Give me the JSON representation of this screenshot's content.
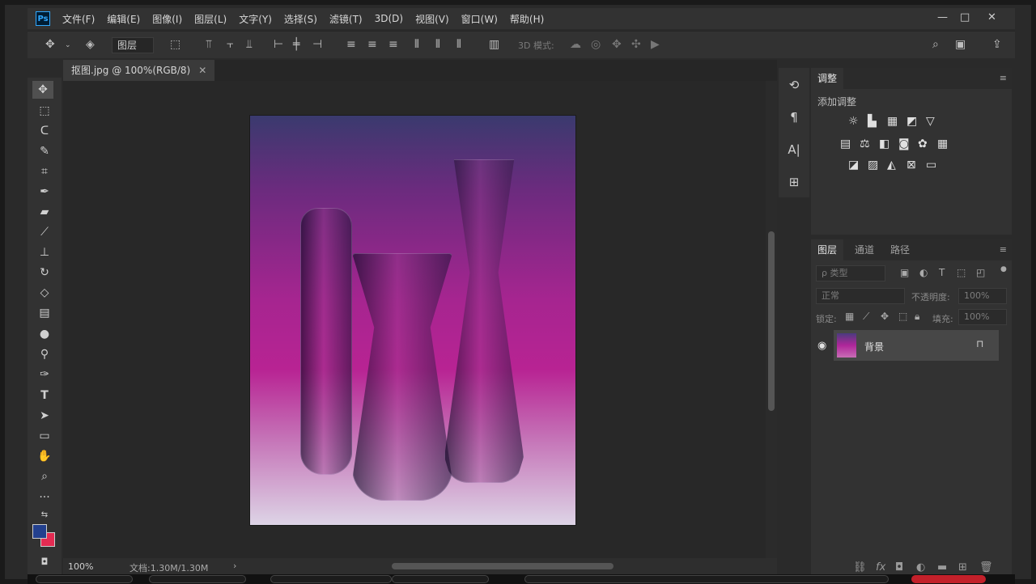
{
  "app": {
    "logo": "Ps"
  },
  "menu": [
    "文件(F)",
    "编辑(E)",
    "图像(I)",
    "图层(L)",
    "文字(Y)",
    "选择(S)",
    "滤镜(T)",
    "3D(D)",
    "视图(V)",
    "窗口(W)",
    "帮助(H)"
  ],
  "window_controls": {
    "minimize": "—",
    "restore": "□",
    "close": "✕"
  },
  "options": {
    "layer_select": "图层",
    "mode_label": "3D 模式:"
  },
  "document": {
    "tab_title": "抠图.jpg @ 100%(RGB/8)",
    "close": "✕"
  },
  "status": {
    "zoom": "100%",
    "doc_info": "文档:1.30M/1.30M",
    "arrow": "›"
  },
  "tools": [
    "move-icon",
    "marquee-icon",
    "lasso-icon",
    "quick-select-icon",
    "crop-icon",
    "eyedropper-icon",
    "healing-brush-icon",
    "brush-icon",
    "clone-stamp-icon",
    "history-brush-icon",
    "eraser-icon",
    "gradient-icon",
    "blur-icon",
    "dodge-icon",
    "pen-icon",
    "type-icon",
    "path-select-icon",
    "rectangle-icon",
    "hand-icon",
    "zoom-icon",
    "more-icon"
  ],
  "colors": {
    "foreground": "#23408e",
    "background": "#e42b52"
  },
  "adjustments": {
    "tab": "调整",
    "subtitle": "添加调整"
  },
  "layers_panel": {
    "tabs": [
      "图层",
      "通道",
      "路径"
    ],
    "filter_placeholder": "ρ 类型",
    "blend_mode": "正常",
    "opacity_label": "不透明度:",
    "opacity_value": "100%",
    "lock_label": "锁定:",
    "fill_label": "填充:",
    "fill_value": "100%",
    "layers": [
      {
        "name": "背景",
        "visible": true,
        "locked": true
      }
    ]
  }
}
